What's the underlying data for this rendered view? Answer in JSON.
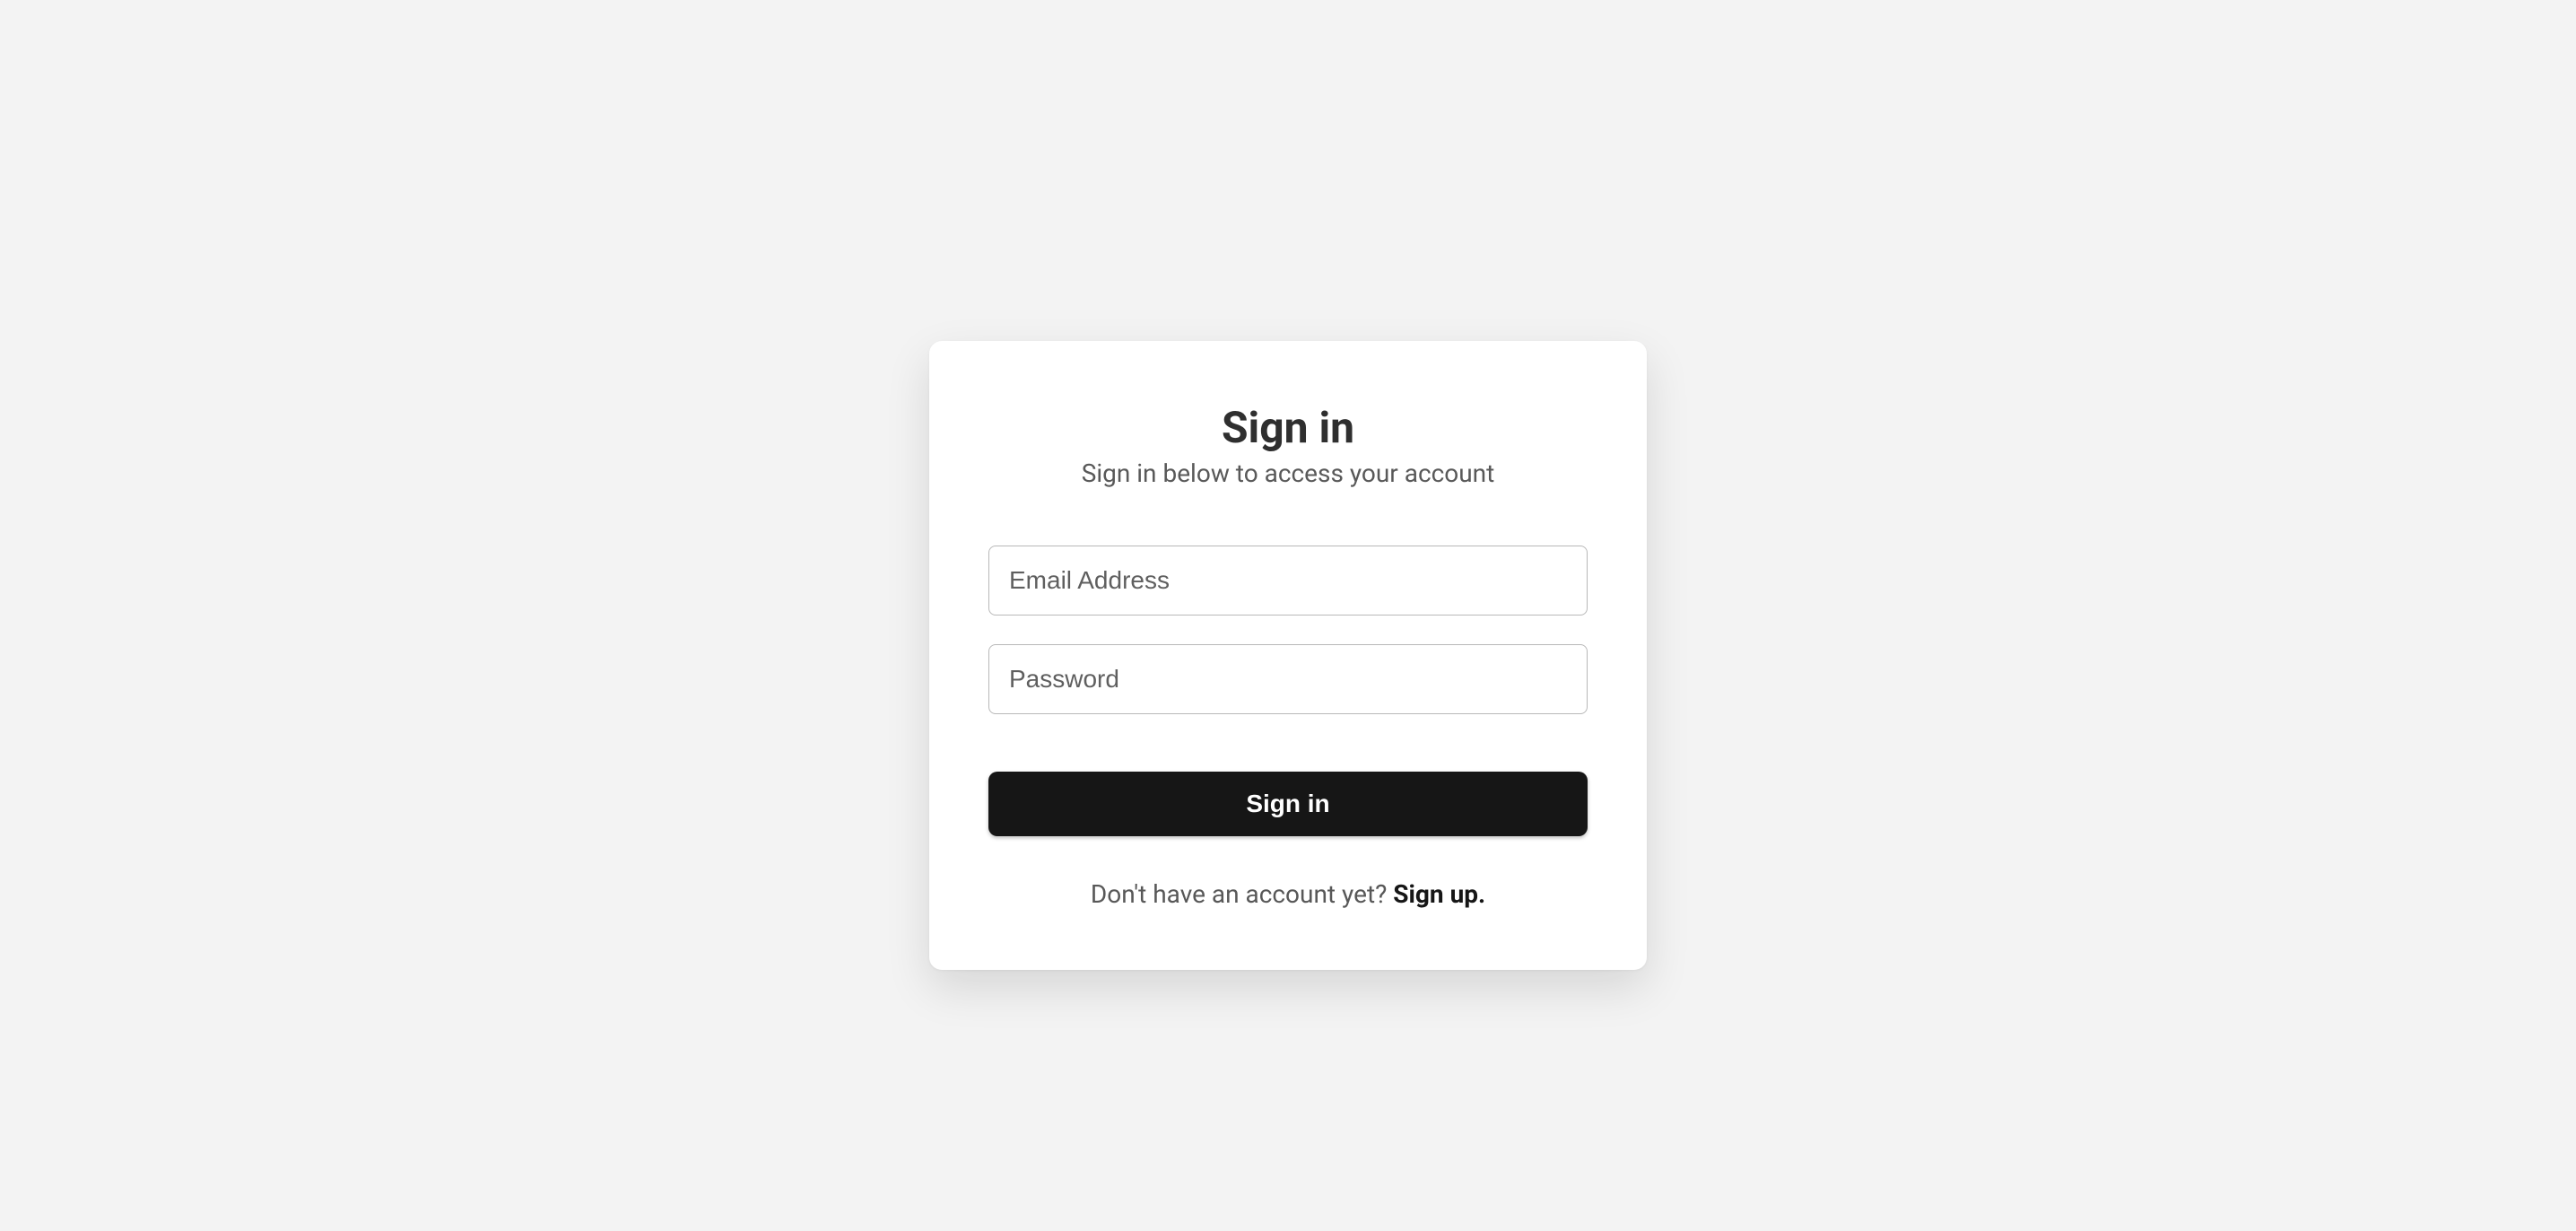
{
  "card": {
    "title": "Sign in",
    "subtitle": "Sign in below to access your account",
    "email_placeholder": "Email Address",
    "password_placeholder": "Password",
    "submit_label": "Sign in",
    "footer_prompt": "Don't have an account yet? ",
    "signup_link": "Sign up."
  }
}
